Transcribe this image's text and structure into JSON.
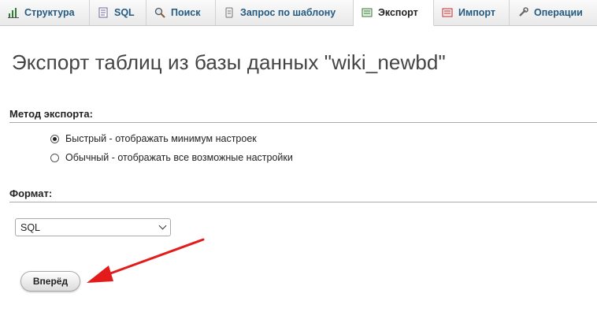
{
  "tabs": [
    {
      "label": "Структура",
      "icon": "structure-icon",
      "active": false
    },
    {
      "label": "SQL",
      "icon": "sql-icon",
      "active": false
    },
    {
      "label": "Поиск",
      "icon": "search-icon",
      "active": false
    },
    {
      "label": "Запрос по шаблону",
      "icon": "query-icon",
      "active": false
    },
    {
      "label": "Экспорт",
      "icon": "export-icon",
      "active": true
    },
    {
      "label": "Импорт",
      "icon": "import-icon",
      "active": false
    },
    {
      "label": "Операции",
      "icon": "wrench-icon",
      "active": false
    }
  ],
  "page": {
    "title": "Экспорт таблиц из базы данных \"wiki_newbd\""
  },
  "export_method": {
    "heading": "Метод экспорта:",
    "options": [
      {
        "label": "Быстрый - отображать минимум настроек",
        "checked": true
      },
      {
        "label": "Обычный - отображать все возможные настройки",
        "checked": false
      }
    ]
  },
  "format": {
    "heading": "Формат:",
    "selected": "SQL"
  },
  "actions": {
    "go_label": "Вперёд"
  },
  "colors": {
    "accent": "#235a81",
    "annotation_arrow": "#e31b1b"
  }
}
